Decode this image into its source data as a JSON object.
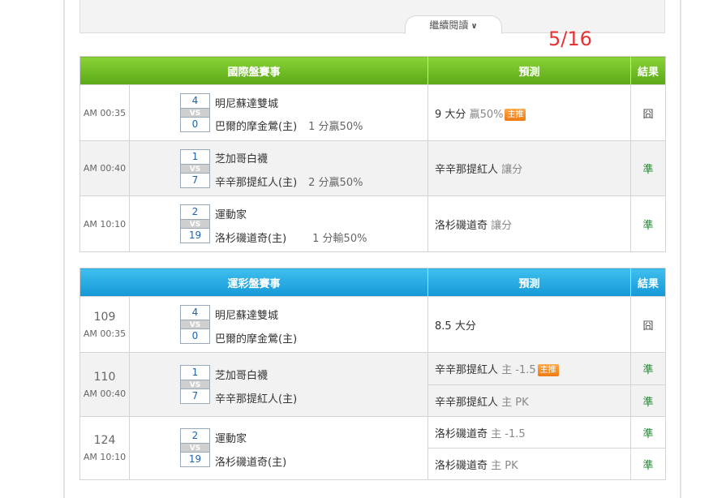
{
  "continue_reading": {
    "label": "繼續閱讀",
    "icon": "chevron-down-icon"
  },
  "date": "5/16",
  "table1": {
    "headers": {
      "match": "國際盤賽事",
      "prediction": "預測",
      "result": "結果"
    },
    "rows": [
      {
        "time": "AM 00:35",
        "away_score": "4",
        "home_score": "0",
        "vs": "VS",
        "away": "明尼蘇達雙城",
        "home": "巴爾的摩金鶯(主)",
        "odds": "1 分贏50%",
        "pred_main": "9 大分",
        "pred_sub": "贏50%",
        "badge": "主推",
        "result": "囧"
      },
      {
        "time": "AM 00:40",
        "away_score": "1",
        "home_score": "7",
        "vs": "VS",
        "away": "芝加哥白襪",
        "home": "辛辛那提紅人(主)",
        "odds": "2 分贏50%",
        "pred_main": "辛辛那提紅人",
        "pred_sub": "讓分",
        "badge": "",
        "result": "準"
      },
      {
        "time": "AM 10:10",
        "away_score": "2",
        "home_score": "19",
        "vs": "VS",
        "away": "運動家",
        "home": "洛杉磯道奇(主)",
        "odds": "1 分輸50%",
        "pred_main": "洛杉磯道奇",
        "pred_sub": "讓分",
        "badge": "",
        "result": "準"
      }
    ]
  },
  "table2": {
    "headers": {
      "match": "運彩盤賽事",
      "prediction": "預測",
      "result": "結果"
    },
    "rows": [
      {
        "num": "109",
        "time": "AM 00:35",
        "away_score": "4",
        "home_score": "0",
        "vs": "VS",
        "away": "明尼蘇達雙城",
        "home": "巴爾的摩金鶯(主)",
        "preds": [
          {
            "main": "8.5 大分",
            "sub": "",
            "badge": "",
            "result": "囧"
          }
        ]
      },
      {
        "num": "110",
        "time": "AM 00:40",
        "away_score": "1",
        "home_score": "7",
        "vs": "VS",
        "away": "芝加哥白襪",
        "home": "辛辛那提紅人(主)",
        "preds": [
          {
            "main": "辛辛那提紅人",
            "sub": "主 -1.5",
            "badge": "主推",
            "result": "準"
          },
          {
            "main": "辛辛那提紅人",
            "sub": "主 PK",
            "badge": "",
            "result": "準"
          }
        ]
      },
      {
        "num": "124",
        "time": "AM 10:10",
        "away_score": "2",
        "home_score": "19",
        "vs": "VS",
        "away": "運動家",
        "home": "洛杉磯道奇(主)",
        "preds": [
          {
            "main": "洛杉磯道奇",
            "sub": "主 -1.5",
            "badge": "",
            "result": "準"
          },
          {
            "main": "洛杉磯道奇",
            "sub": "主 PK",
            "badge": "",
            "result": "準"
          }
        ]
      }
    ]
  },
  "colors": {
    "green_header": "#5aa816",
    "blue_header": "#1597d6",
    "date_red": "#e53333",
    "hit_green": "#1a8a2c",
    "badge_orange": "#ef7a12"
  }
}
